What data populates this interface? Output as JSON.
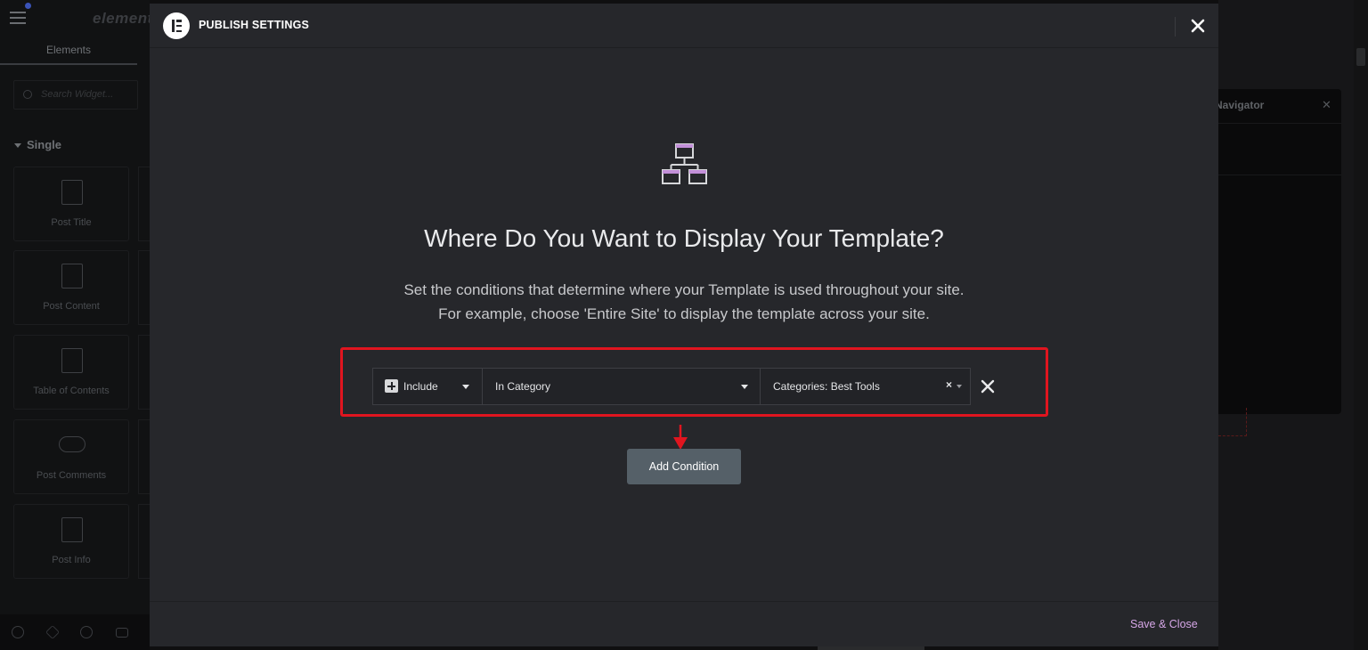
{
  "editor": {
    "brand": "elementor",
    "panel_tab": "Elements",
    "search_placeholder": "Search Widget...",
    "section_label": "Single",
    "widgets": [
      {
        "label": "Post Title",
        "icon": "post-title-icon"
      },
      {
        "label": "Post Content",
        "icon": "post-content-icon"
      },
      {
        "label": "Table of Contents",
        "icon": "table-of-contents-icon"
      },
      {
        "label": "Post Comments",
        "icon": "post-comments-icon"
      },
      {
        "label": "Post Info",
        "icon": "post-info-icon"
      }
    ],
    "footer_icons": [
      "settings-icon",
      "layers-icon",
      "history-icon",
      "responsive-icon"
    ]
  },
  "navigator": {
    "title": "Navigator"
  },
  "modal": {
    "title": "PUBLISH SETTINGS",
    "heading": "Where Do You Want to Display Your Template?",
    "description_line1": "Set the conditions that determine where your Template is used throughout your site.",
    "description_line2": "For example, choose 'Entire Site' to display the template across your site.",
    "condition": {
      "type": "Include",
      "sub_type": "In Category",
      "object": "Categories: Best Tools"
    },
    "add_condition_label": "Add Condition",
    "save_close_label": "Save & Close",
    "colors": {
      "highlight": "#e0151f",
      "accent_link": "#d5a6e6",
      "sitemap_accent": "#c28fd8"
    }
  }
}
